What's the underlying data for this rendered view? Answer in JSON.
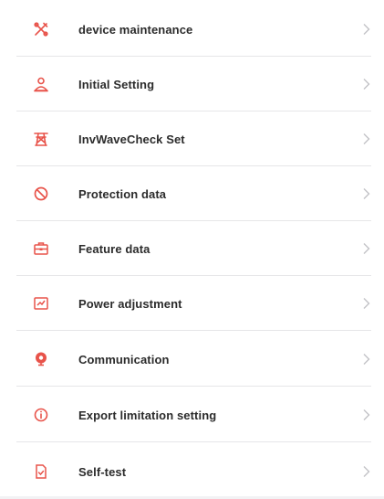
{
  "colors": {
    "accent": "#e8534a",
    "text": "#2b2b2b",
    "chevron": "#c2c2c6",
    "divider": "#e6e6e8"
  },
  "menu": {
    "items": [
      {
        "label": "device maintenance",
        "icon": "tools-icon"
      },
      {
        "label": "Initial Setting",
        "icon": "user-settings-icon"
      },
      {
        "label": "InvWaveCheck Set",
        "icon": "power-tower-icon"
      },
      {
        "label": "Protection data",
        "icon": "prohibit-icon"
      },
      {
        "label": "Feature data",
        "icon": "briefcase-icon"
      },
      {
        "label": "Power adjustment",
        "icon": "adjust-panel-icon"
      },
      {
        "label": "Communication",
        "icon": "communication-icon"
      },
      {
        "label": "Export limitation setting",
        "icon": "info-circle-icon"
      },
      {
        "label": "Self-test",
        "icon": "document-check-icon"
      }
    ]
  }
}
